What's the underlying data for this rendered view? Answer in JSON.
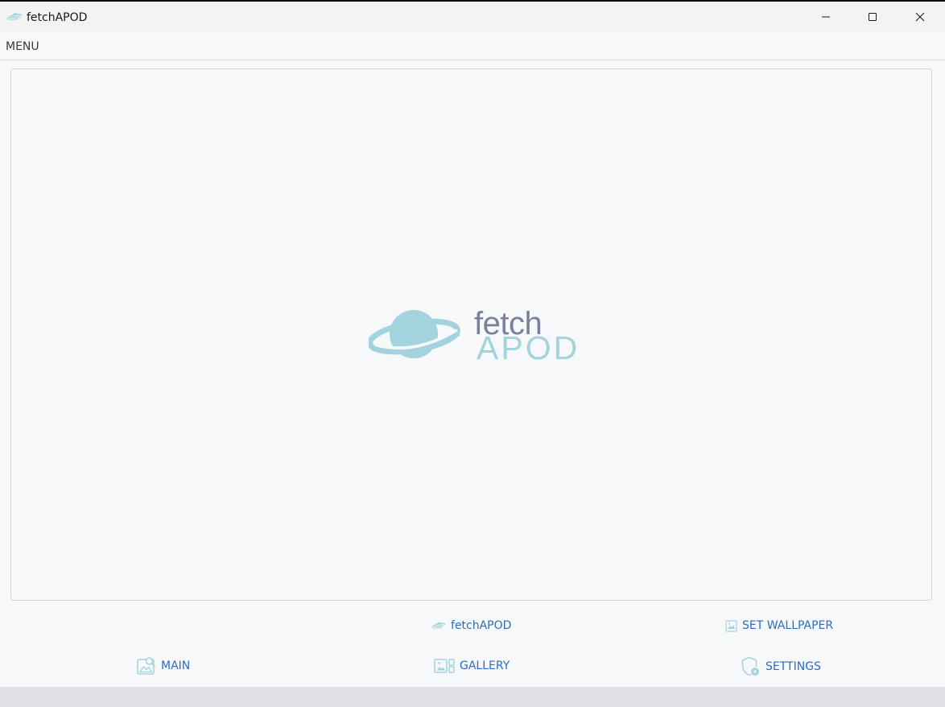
{
  "window": {
    "title": "fetchAPOD",
    "icon": "planet-icon"
  },
  "menu": {
    "label": "MENU"
  },
  "logo": {
    "line1": "fetch",
    "line2": "APOD"
  },
  "toolbar": {
    "brand_label": "fetchAPOD",
    "set_wallpaper_label": "SET WALLPAPER"
  },
  "nav": {
    "main_label": "MAIN",
    "gallery_label": "GALLERY",
    "settings_label": "SETTINGS"
  },
  "colors": {
    "accent": "#2a6dc4",
    "logo_planet": "#a3d3dc",
    "logo_text": "#7a7f9c",
    "background": "#f7f8fa"
  }
}
